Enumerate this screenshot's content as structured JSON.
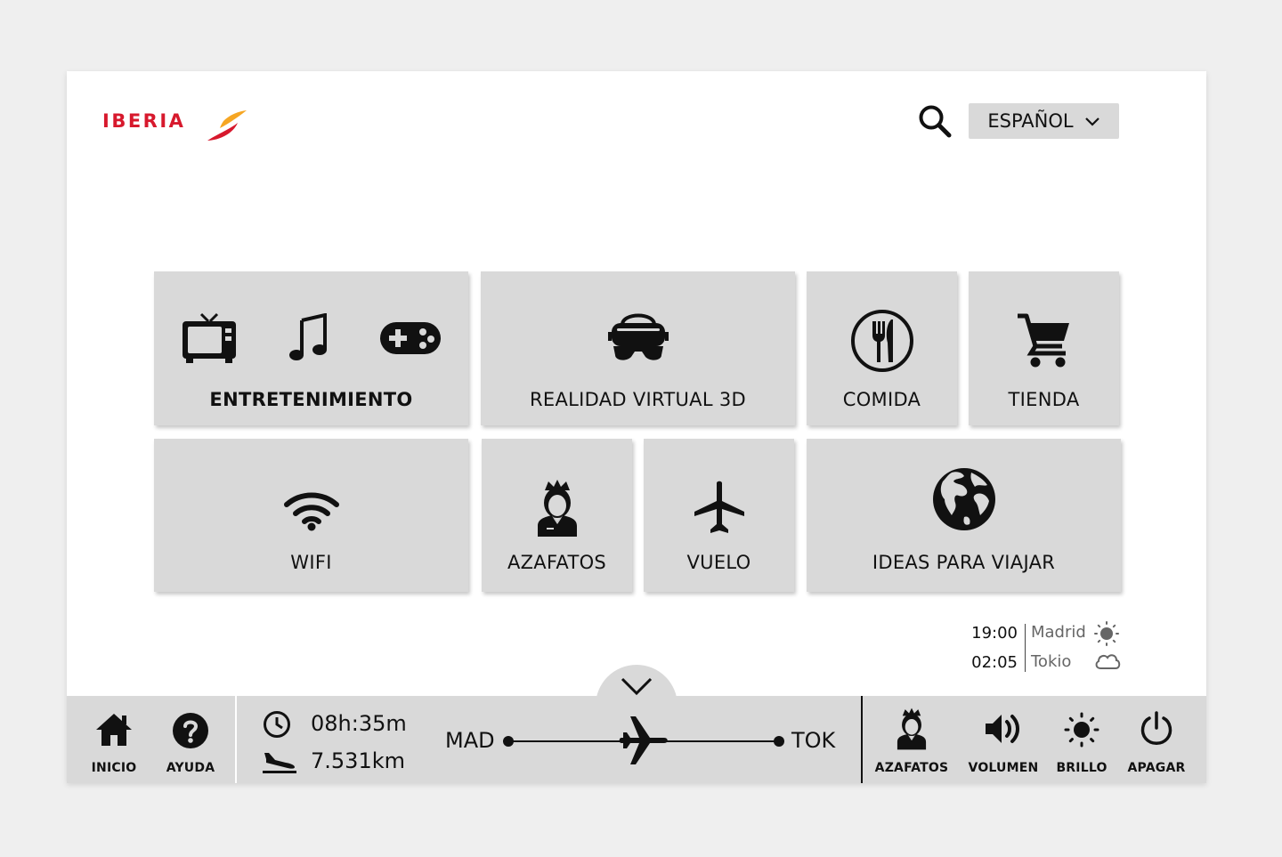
{
  "header": {
    "brand": "IBERIA",
    "language": "ESPAÑOL"
  },
  "tiles": {
    "entertainment": "ENTRETENIMIENTO",
    "vr": "REALIDAD VIRTUAL 3D",
    "food": "COMIDA",
    "shop": "TIENDA",
    "wifi": "WIFI",
    "attendants": "AZAFATOS",
    "flight": "VUELO",
    "travel_ideas": "IDEAS PARA VIAJAR"
  },
  "clock": {
    "origin": {
      "time": "19:00",
      "city": "Madrid",
      "weather_icon": "sun-icon"
    },
    "destination": {
      "time": "02:05",
      "city": "Tokio",
      "weather_icon": "cloud-icon"
    }
  },
  "bottom_bar": {
    "home": "INICIO",
    "help": "AYUDA",
    "remaining_time": "08h:35m",
    "remaining_distance": "7.531km",
    "origin_code": "MAD",
    "destination_code": "TOK",
    "flight_progress": 0.5,
    "attendants": "AZAFATOS",
    "volume": "VOLUMEN",
    "brightness": "BRILLO",
    "power": "APAGAR"
  },
  "colors": {
    "brand_red": "#d7192d",
    "brand_orange": "#f6a623",
    "tile_gray": "#d9d9d9",
    "background": "#efefef"
  }
}
